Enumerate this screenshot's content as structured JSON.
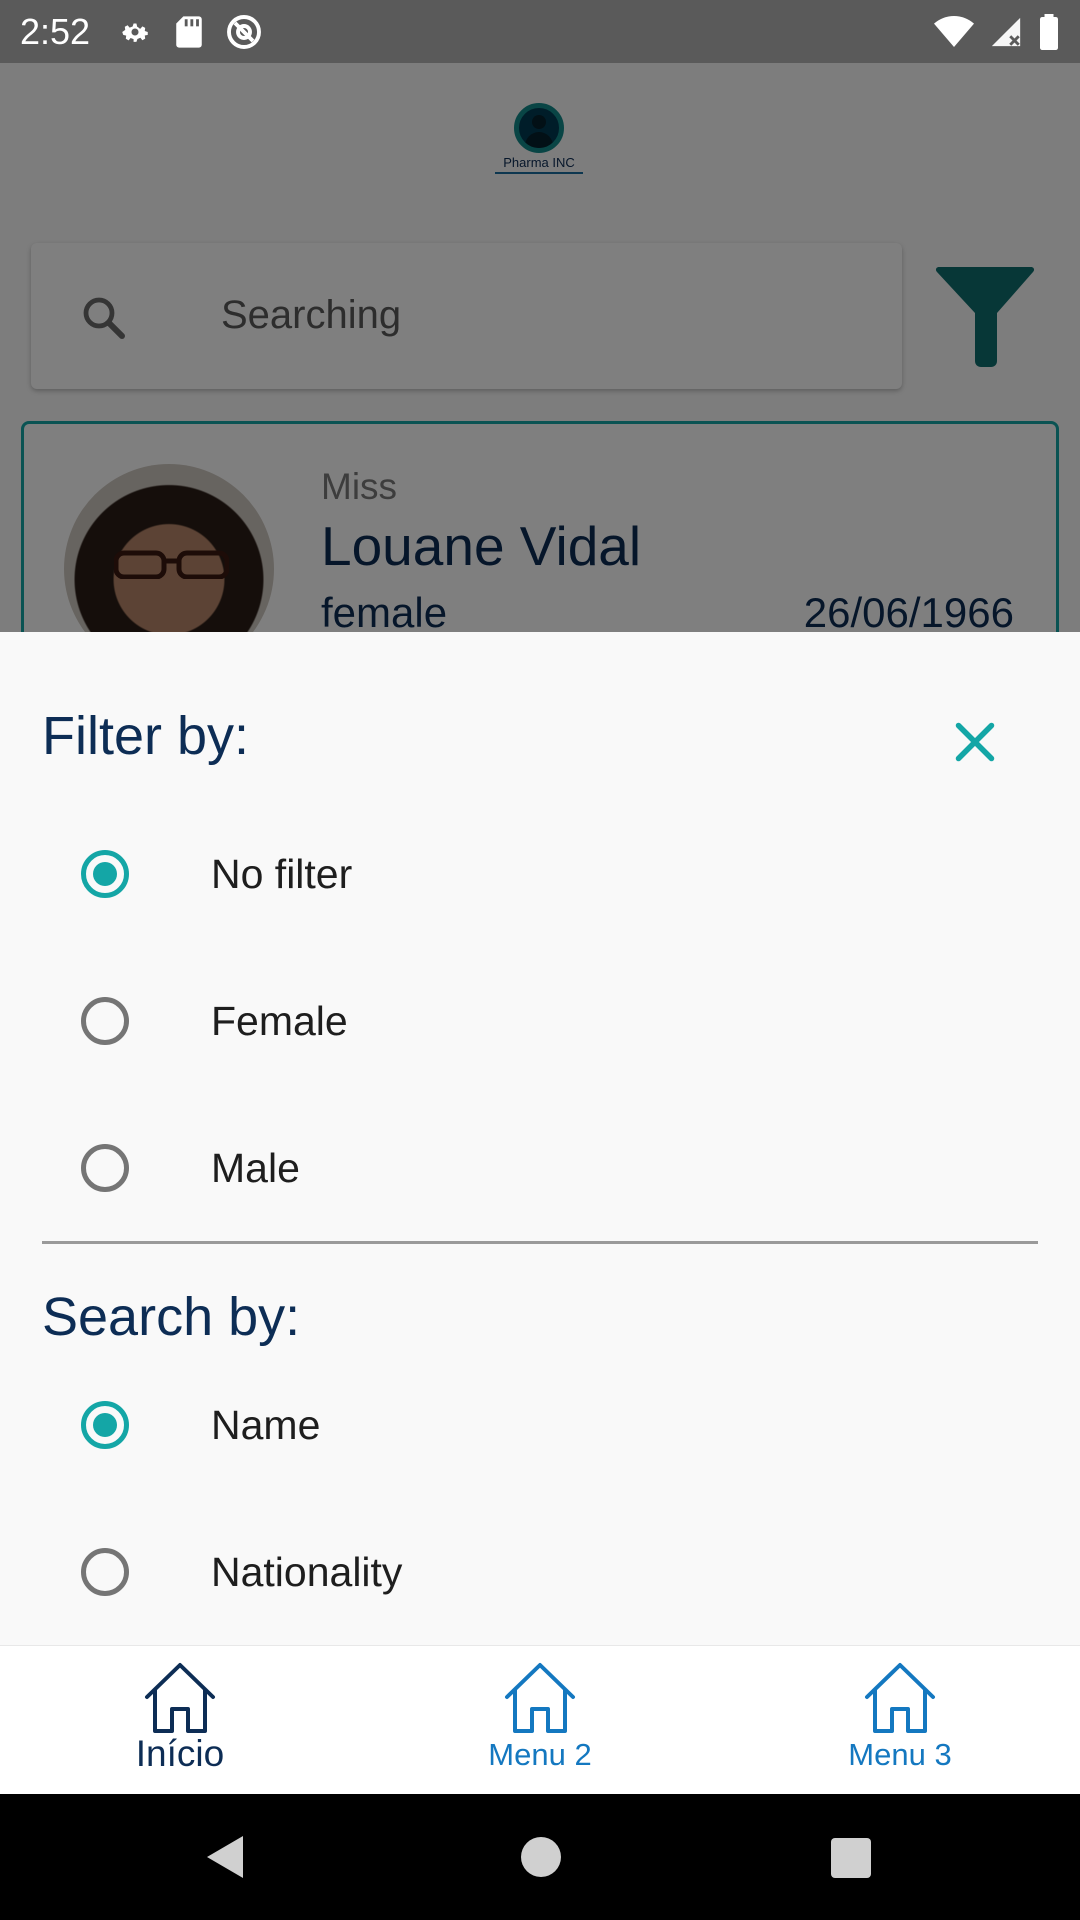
{
  "status_bar": {
    "time": "2:52",
    "left_icons": [
      "gear-icon",
      "sd-card-icon",
      "at-sign-icon"
    ],
    "right_icons": [
      "wifi-icon",
      "cell-signal-icon",
      "battery-icon"
    ]
  },
  "app": {
    "logo_text": "Pharma INC",
    "search": {
      "placeholder": "Searching"
    },
    "person": {
      "title": "Miss",
      "name": "Louane Vidal",
      "gender": "female",
      "dob": "26/06/1966"
    }
  },
  "sheet": {
    "filter_title": "Filter by:",
    "filter_options": [
      {
        "label": "No filter",
        "selected": true
      },
      {
        "label": "Female",
        "selected": false
      },
      {
        "label": "Male",
        "selected": false
      }
    ],
    "search_title": "Search by:",
    "search_options": [
      {
        "label": "Name",
        "selected": true
      },
      {
        "label": "Nationality",
        "selected": false
      }
    ]
  },
  "bottom_nav": {
    "items": [
      {
        "label": "Início",
        "icon": "home-icon",
        "active": true
      },
      {
        "label": "Menu 2",
        "icon": "home-icon",
        "active": false
      },
      {
        "label": "Menu 3",
        "icon": "home-icon",
        "active": false
      }
    ]
  },
  "colors": {
    "accent": "#14a6a6",
    "primary_text": "#0d2d55",
    "nav_link": "#1478c0",
    "filter_icon": "#0f6e6e"
  }
}
